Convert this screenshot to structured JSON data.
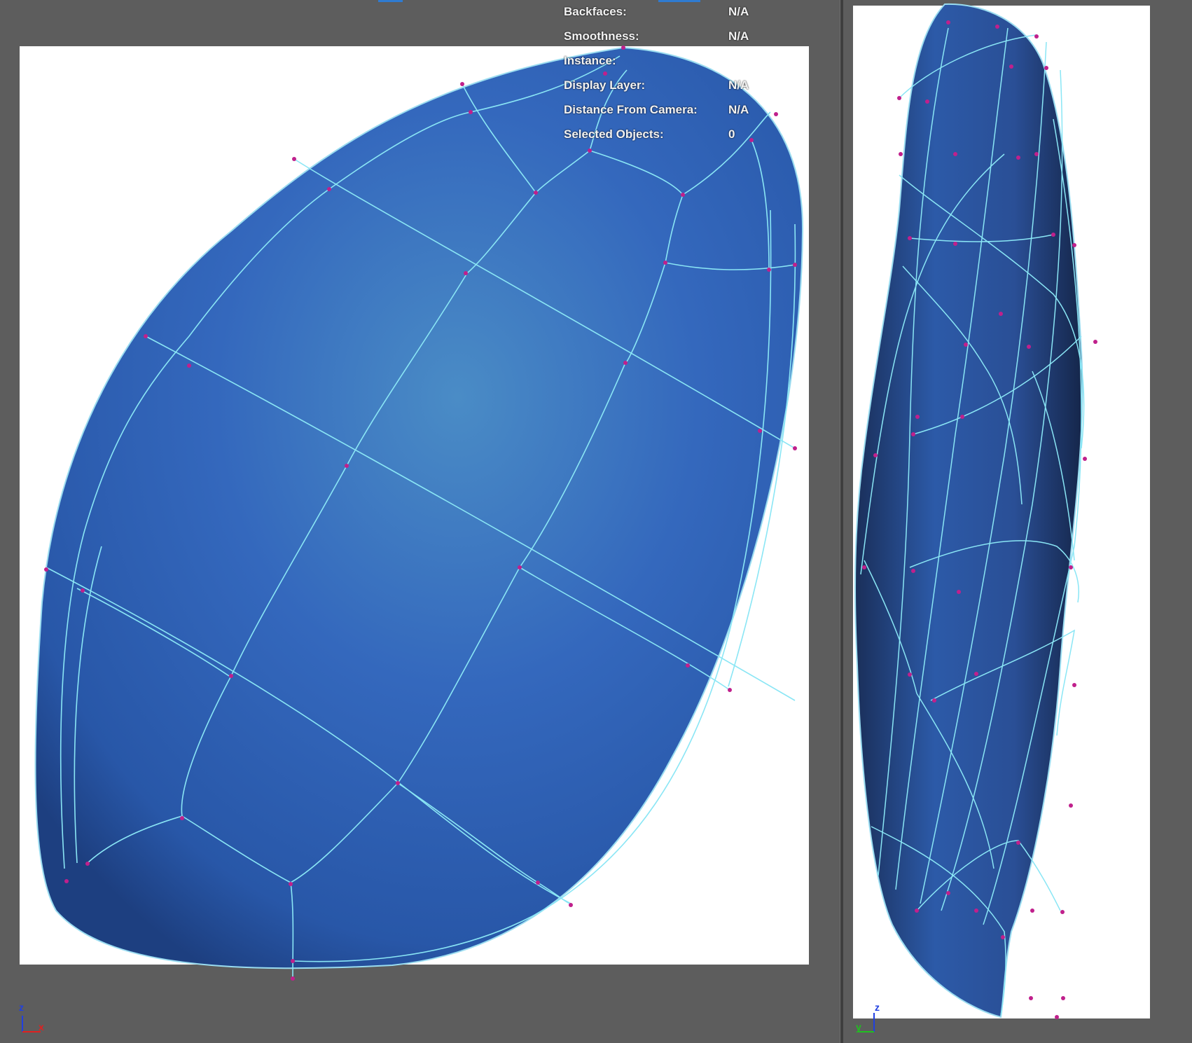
{
  "hud": {
    "rows": [
      {
        "label": "Backfaces:",
        "value": "N/A"
      },
      {
        "label": "Smoothness:",
        "value": "N/A"
      },
      {
        "label": "Instance:",
        "value": ""
      },
      {
        "label": "Display Layer:",
        "value": "N/A"
      },
      {
        "label": "Distance From Camera:",
        "value": "N/A"
      },
      {
        "label": "Selected Objects:",
        "value": "0"
      }
    ]
  },
  "left_axis": {
    "z": "z",
    "x": "x"
  },
  "right_axis": {
    "z": "z",
    "y": "y"
  },
  "colors": {
    "viewport_bg": "#5d5d5d",
    "canvas": "#ffffff",
    "mesh_fill": "#2f64b8",
    "wire": "#7fe0f0",
    "vertex": "#c0208c",
    "axis_x": "#e02020",
    "axis_y": "#20c020",
    "axis_z": "#2040e0"
  }
}
